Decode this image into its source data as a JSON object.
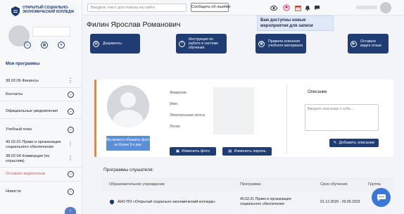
{
  "sidebar": {
    "logo_text": "ОТКРЫТЫЙ СОЦИАЛЬНО-ЭКОНОМИЧЕСКИЙ КОЛЛЕДЖ",
    "section_title": "Мои программы",
    "items": [
      {
        "label": "38.02.06 Финансы"
      },
      {
        "label": "Контакты"
      },
      {
        "label": "Официальные уведомления"
      },
      {
        "label": "Учебный план"
      },
      {
        "label": "40.02.01 Право и организация социального обеспечения"
      },
      {
        "label": "38.02.04 Коммерция (по отраслям)"
      },
      {
        "label": "Оставьте видеоотзыв"
      },
      {
        "label": "Новости"
      }
    ]
  },
  "topbar": {
    "search_placeholder": "Введите текст для поиска на сайте",
    "report_label": "Сообщить об ошибке"
  },
  "notification": {
    "text": "Вам доступны новые мероприятия для записи"
  },
  "main": {
    "title": "Филин Ярослав Романович",
    "quick_buttons": [
      {
        "label": "Документы",
        "icon": "document-icon"
      },
      {
        "label": "Инструкция по работе в системе обучения",
        "icon": "question-icon"
      },
      {
        "label": "Правила освоения учебного материала",
        "icon": "doc-rules-icon"
      },
      {
        "label": "Оставьте видео отзыв",
        "icon": "video-icon"
      }
    ],
    "profile": {
      "photo_note": "Вы можете обновить фото не более 3-х раз.",
      "fields": [
        "Фамилия",
        "Имя",
        "Электронная почта",
        "Логин"
      ],
      "change_photo": "Изменить фото",
      "change_password": "Изменить пароль",
      "description_label": "Описание",
      "description_placeholder": "Введите описание о себе...",
      "add_description": "Добавить описание"
    },
    "programs": {
      "title": "Программы слушателя:",
      "columns": [
        "Образовательное учреждение",
        "Программа",
        "Срок обучения",
        "Группа"
      ],
      "rows": [
        {
          "institution": "АНО ПО «Открытый социально-экономический колледж»",
          "program": "40.02.01 Право и организация социального обеспечения",
          "period": "01.12.2020 - 29.09.2023",
          "group": ""
        }
      ]
    }
  },
  "colors": {
    "accent": "#1f3d72",
    "orange": "#e28a3c",
    "note": "#5a8fd6",
    "chat": "#3a78d6"
  }
}
